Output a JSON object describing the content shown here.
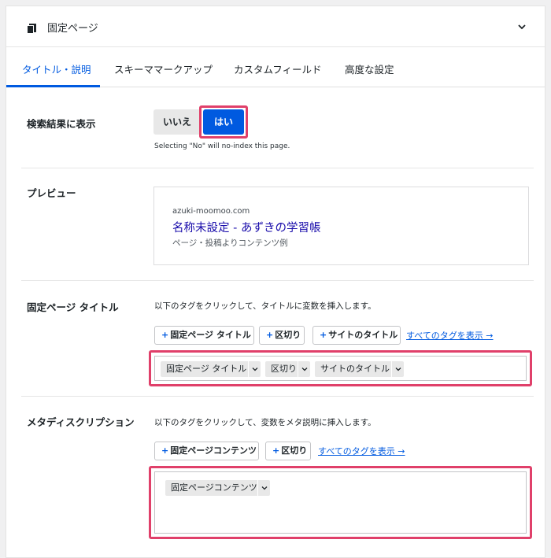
{
  "header": {
    "title": "固定ページ"
  },
  "tabs": [
    {
      "label": "タイトル・説明"
    },
    {
      "label": "スキーママークアップ"
    },
    {
      "label": "カスタムフィールド"
    },
    {
      "label": "高度な設定"
    }
  ],
  "search_visibility": {
    "label": "検索結果に表示",
    "no_label": "いいえ",
    "yes_label": "はい",
    "hint": "Selecting \"No\" will no-index this page."
  },
  "preview": {
    "label": "プレビュー",
    "url": "azuki-moomoo.com",
    "title": "名称未設定 - あずきの学習帳",
    "description": "ページ・投稿よりコンテンツ例"
  },
  "page_title": {
    "label": "固定ページ タイトル",
    "instruction": "以下のタグをクリックして、タイトルに変数を挿入します。",
    "tag_buttons": [
      "固定ページ タイトル",
      "区切り",
      "サイトのタイトル"
    ],
    "show_all_link": "すべてのタグを表示 →",
    "chips": [
      "固定ページ タイトル",
      "区切り",
      "サイトのタイトル"
    ]
  },
  "meta_description": {
    "label": "メタディスクリプション",
    "instruction": "以下のタグをクリックして、変数をメタ説明に挿入します。",
    "tag_buttons": [
      "固定ページコンテンツ",
      "区切り"
    ],
    "show_all_link": "すべてのタグを表示 →",
    "chips": [
      "固定ページコンテンツ"
    ]
  },
  "colors": {
    "accent": "#005ae0",
    "highlight": "#e0406a"
  }
}
